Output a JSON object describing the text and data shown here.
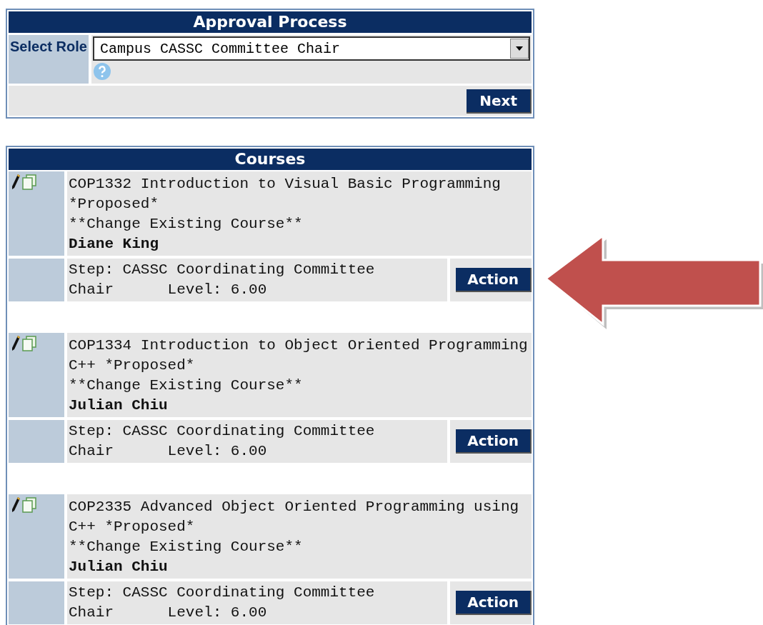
{
  "approval_panel": {
    "title": "Approval Process",
    "role_label": "Select Role",
    "role_select": {
      "value": "Campus CASSC Committee Chair"
    },
    "next_button": "Next"
  },
  "courses_panel": {
    "title": "Courses",
    "courses": [
      {
        "title": "COP1332 Introduction to Visual Basic Programming *Proposed*",
        "change": "**Change Existing Course**",
        "author": "Diane King",
        "step": "Step: CASSC Coordinating Committee Chair",
        "level": "Level: 6.00",
        "action": "Action"
      },
      {
        "title": "COP1334 Introduction to Object Oriented Programming C++ *Proposed*",
        "change": "**Change Existing Course**",
        "author": "Julian Chiu",
        "step": "Step: CASSC Coordinating Committee Chair",
        "level": "Level: 6.00",
        "action": "Action"
      },
      {
        "title": "COP2335 Advanced Object Oriented Programming using C++ *Proposed*",
        "change": "**Change Existing Course**",
        "author": "Julian Chiu",
        "step": "Step: CASSC Coordinating Committee Chair",
        "level": "Level: 6.00",
        "action": "Action"
      }
    ]
  }
}
